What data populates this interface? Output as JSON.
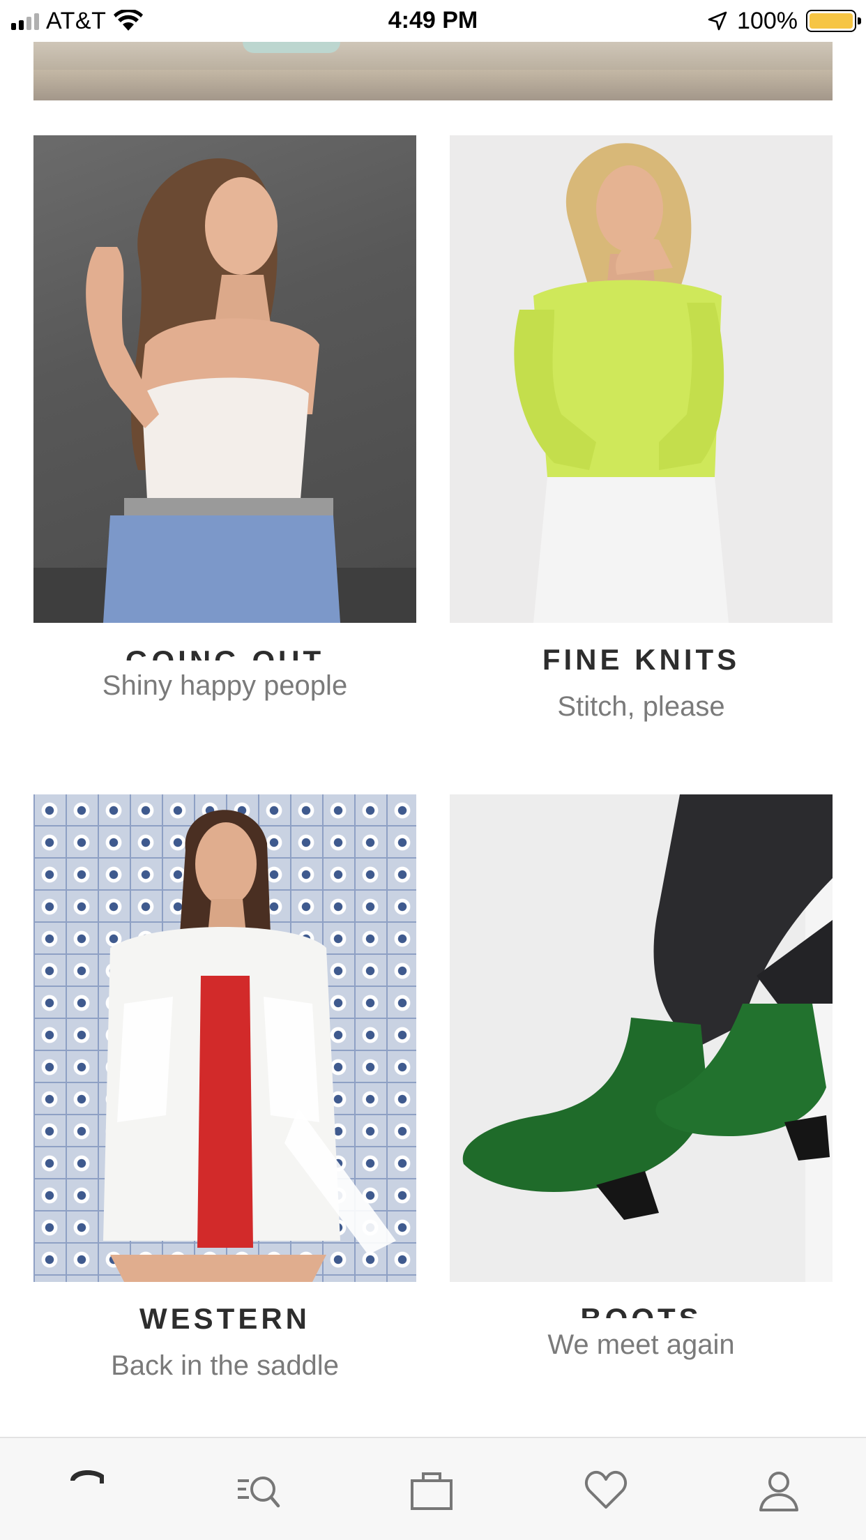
{
  "status_bar": {
    "carrier": "AT&T",
    "time": "4:49 PM",
    "battery": "100%",
    "battery_color": "#f6c544"
  },
  "tiles": [
    {
      "title": "GOING OUT",
      "subtitle": "Shiny happy people"
    },
    {
      "title": "FINE KNITS",
      "subtitle": "Stitch, please"
    },
    {
      "title": "WESTERN",
      "subtitle": "Back in the saddle"
    },
    {
      "title": "BOOTS",
      "subtitle": "We meet again"
    }
  ],
  "nav": {
    "items": [
      "home-icon",
      "search-icon",
      "bag-icon",
      "heart-icon",
      "account-icon"
    ]
  }
}
